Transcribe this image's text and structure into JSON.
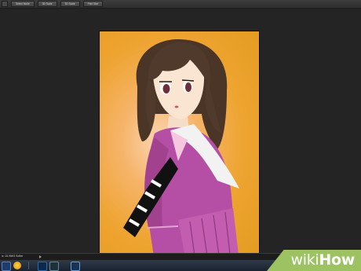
{
  "toolbar": {
    "buttons": [
      {
        "label": "Select Mode"
      },
      {
        "label": "3D Scale"
      },
      {
        "label": "3D Scale"
      },
      {
        "label": "Print Size"
      }
    ]
  },
  "status_bar": {
    "text": "ic: 24.9M/3 Softer"
  },
  "taskbar": {
    "apps": [
      "mail-icon",
      "browser-icon",
      "photoshop-icon",
      "after-effects-icon",
      "premiere-icon"
    ]
  },
  "watermark": {
    "brand_prefix": "wiki",
    "brand_suffix": "How",
    "color": "#9cc261"
  },
  "colors": {
    "background_orange": "#eea430",
    "uniform_magenta": "#b44fa5",
    "hair_brown": "#4a3527"
  }
}
